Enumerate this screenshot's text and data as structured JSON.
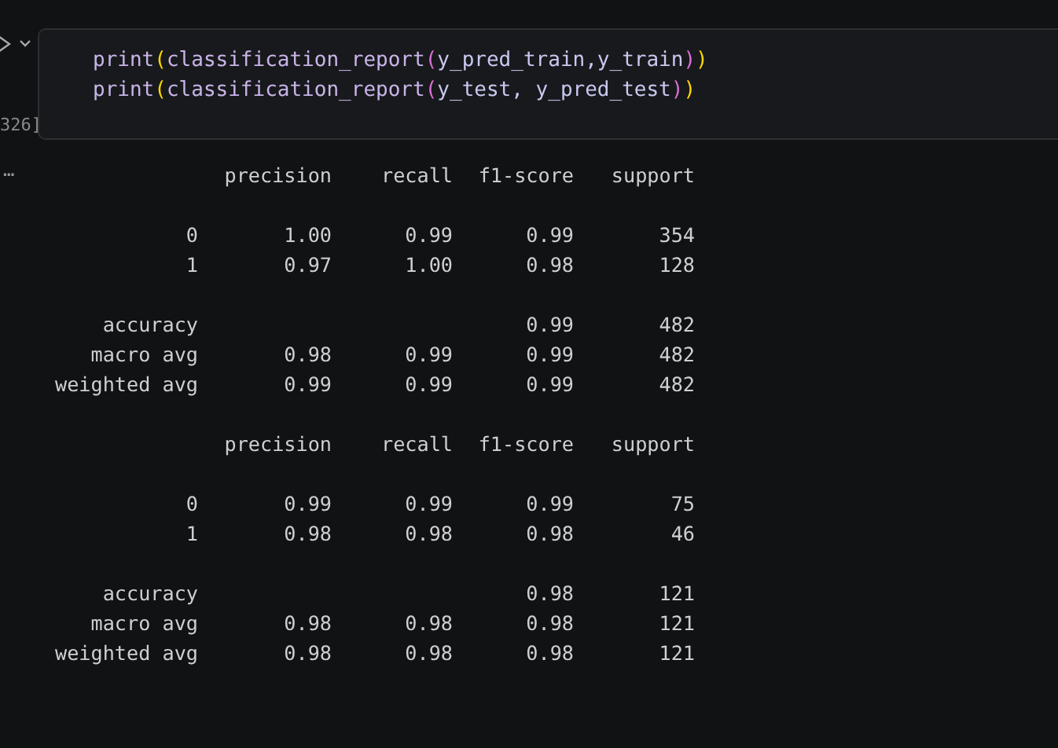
{
  "cell": {
    "execution_count": "326]",
    "code_lines": [
      [
        {
          "text": "print",
          "kind": "func"
        },
        {
          "text": "(",
          "kind": "paren1"
        },
        {
          "text": "classification_report",
          "kind": "func"
        },
        {
          "text": "(",
          "kind": "paren2"
        },
        {
          "text": "y_pred_train,y_train",
          "kind": "var"
        },
        {
          "text": ")",
          "kind": "paren2"
        },
        {
          "text": ")",
          "kind": "paren1"
        }
      ],
      [
        {
          "text": "print",
          "kind": "func"
        },
        {
          "text": "(",
          "kind": "paren1"
        },
        {
          "text": "classification_report",
          "kind": "func"
        },
        {
          "text": "(",
          "kind": "paren2"
        },
        {
          "text": "y_test, y_pred_test",
          "kind": "var"
        },
        {
          "text": ")",
          "kind": "paren2"
        },
        {
          "text": ")",
          "kind": "paren1"
        }
      ]
    ]
  },
  "output": {
    "more_marker": "…",
    "reports": [
      {
        "columns": [
          "precision",
          "recall",
          "f1-score",
          "support"
        ],
        "classes": [
          {
            "label": "0",
            "precision": "1.00",
            "recall": "0.99",
            "f1_score": "0.99",
            "support": "354"
          },
          {
            "label": "1",
            "precision": "0.97",
            "recall": "1.00",
            "f1_score": "0.98",
            "support": "128"
          }
        ],
        "summary": [
          {
            "label": "accuracy",
            "f1_score": "0.99",
            "support": "482"
          },
          {
            "label": "macro avg",
            "precision": "0.98",
            "recall": "0.99",
            "f1_score": "0.99",
            "support": "482"
          },
          {
            "label": "weighted avg",
            "precision": "0.99",
            "recall": "0.99",
            "f1_score": "0.99",
            "support": "482"
          }
        ]
      },
      {
        "columns": [
          "precision",
          "recall",
          "f1-score",
          "support"
        ],
        "classes": [
          {
            "label": "0",
            "precision": "0.99",
            "recall": "0.99",
            "f1_score": "0.99",
            "support": "75"
          },
          {
            "label": "1",
            "precision": "0.98",
            "recall": "0.98",
            "f1_score": "0.98",
            "support": "46"
          }
        ],
        "summary": [
          {
            "label": "accuracy",
            "f1_score": "0.98",
            "support": "121"
          },
          {
            "label": "macro avg",
            "precision": "0.98",
            "recall": "0.98",
            "f1_score": "0.98",
            "support": "121"
          },
          {
            "label": "weighted avg",
            "precision": "0.98",
            "recall": "0.98",
            "f1_score": "0.98",
            "support": "121"
          }
        ]
      }
    ]
  }
}
